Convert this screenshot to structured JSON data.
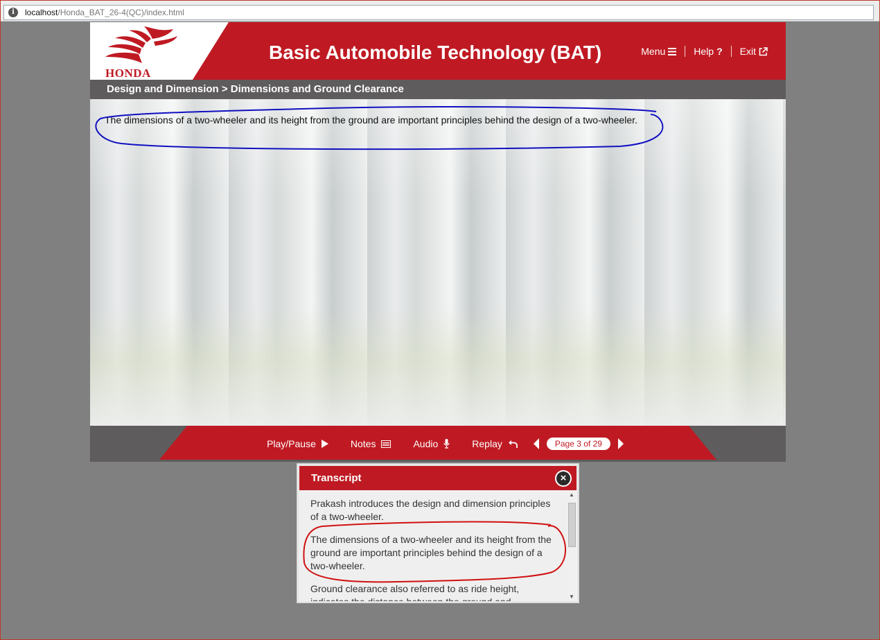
{
  "browser": {
    "url_host": "localhost",
    "url_path": "/Honda_BAT_26-4(QC)/index.html"
  },
  "header": {
    "brand": "HONDA",
    "title": "Basic Automobile Technology (BAT)",
    "nav": [
      {
        "label": "Menu",
        "icon": "hamburger-icon"
      },
      {
        "label": "Help",
        "icon": "question-icon"
      },
      {
        "label": "Exit",
        "icon": "external-link-icon"
      }
    ]
  },
  "breadcrumb": "Design and Dimension > Dimensions and Ground Clearance",
  "stage": {
    "text": "The dimensions of a two-wheeler and its height from the ground are important principles behind the design of a two-wheeler."
  },
  "controls": {
    "play_pause": "Play/Pause",
    "notes": "Notes",
    "audio": "Audio",
    "replay": "Replay",
    "page_indicator": "Page 3 of 29"
  },
  "transcript": {
    "title": "Transcript",
    "paragraphs": [
      "Prakash introduces the design and dimension principles of a two-wheeler.",
      "The dimensions of a two-wheeler and its height from the ground are important principles behind the design of a two-wheeler.",
      "Ground clearance also referred to as ride height, indicates the distance between the ground and"
    ]
  },
  "colors": {
    "brand_red": "#bf1a23",
    "bar_gray": "#5e5c5c",
    "page_bg": "#808080",
    "annotation_blue": "#1010c0",
    "annotation_red": "#d01010"
  }
}
